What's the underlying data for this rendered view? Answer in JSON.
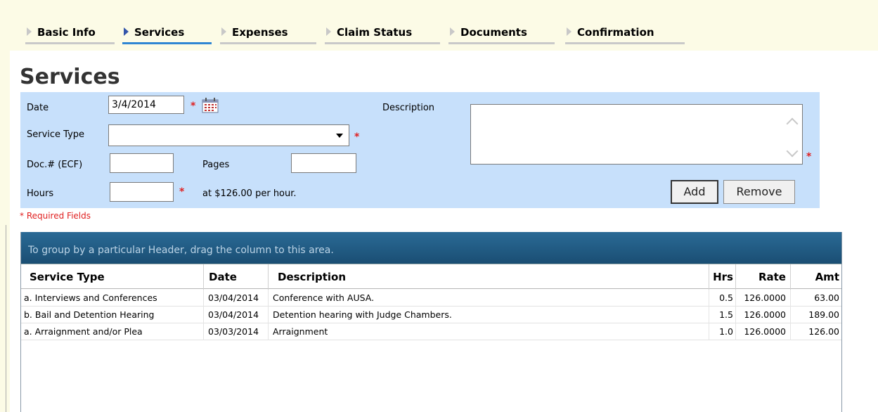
{
  "tabs": [
    {
      "label": "Basic Info",
      "active": false
    },
    {
      "label": "Services",
      "active": true
    },
    {
      "label": "Expenses",
      "active": false
    },
    {
      "label": "Claim Status",
      "active": false
    },
    {
      "label": "Documents",
      "active": false
    },
    {
      "label": "Confirmation",
      "active": false
    }
  ],
  "page_title": "Services",
  "form": {
    "date_label": "Date",
    "date_value": "3/4/2014",
    "service_type_label": "Service Type",
    "service_type_value": "",
    "doc_label": "Doc.# (ECF)",
    "doc_value": "",
    "pages_label": "Pages",
    "pages_value": "",
    "hours_label": "Hours",
    "hours_value": "",
    "rate_text": "at $126.00 per hour.",
    "description_label": "Description",
    "description_value": "",
    "required_marker": "*",
    "add_label": "Add",
    "remove_label": "Remove"
  },
  "required_note": "* Required Fields",
  "grid": {
    "group_hint": "To group by a particular Header, drag the column to this area.",
    "columns": [
      "Service Type",
      "Date",
      "Description",
      "Hrs",
      "Rate",
      "Amt"
    ],
    "rows": [
      {
        "service_type": "a. Interviews and Conferences",
        "date": "03/04/2014",
        "description": "Conference with AUSA.",
        "hrs": "0.5",
        "rate": "126.0000",
        "amt": "63.00"
      },
      {
        "service_type": "b. Bail and Detention Hearing",
        "date": "03/04/2014",
        "description": "Detention hearing with Judge Chambers.",
        "hrs": "1.5",
        "rate": "126.0000",
        "amt": "189.00"
      },
      {
        "service_type": "a. Arraignment and/or Plea",
        "date": "03/03/2014",
        "description": "Arraignment",
        "hrs": "1.0",
        "rate": "126.0000",
        "amt": "126.00"
      }
    ]
  },
  "colors": {
    "panel_bg": "#c7e0fb",
    "tabstrip_bg": "#fcfbe6",
    "active_tab_underline": "#2f86d3",
    "required": "#e02020",
    "group_bar": "#1a4e73"
  }
}
